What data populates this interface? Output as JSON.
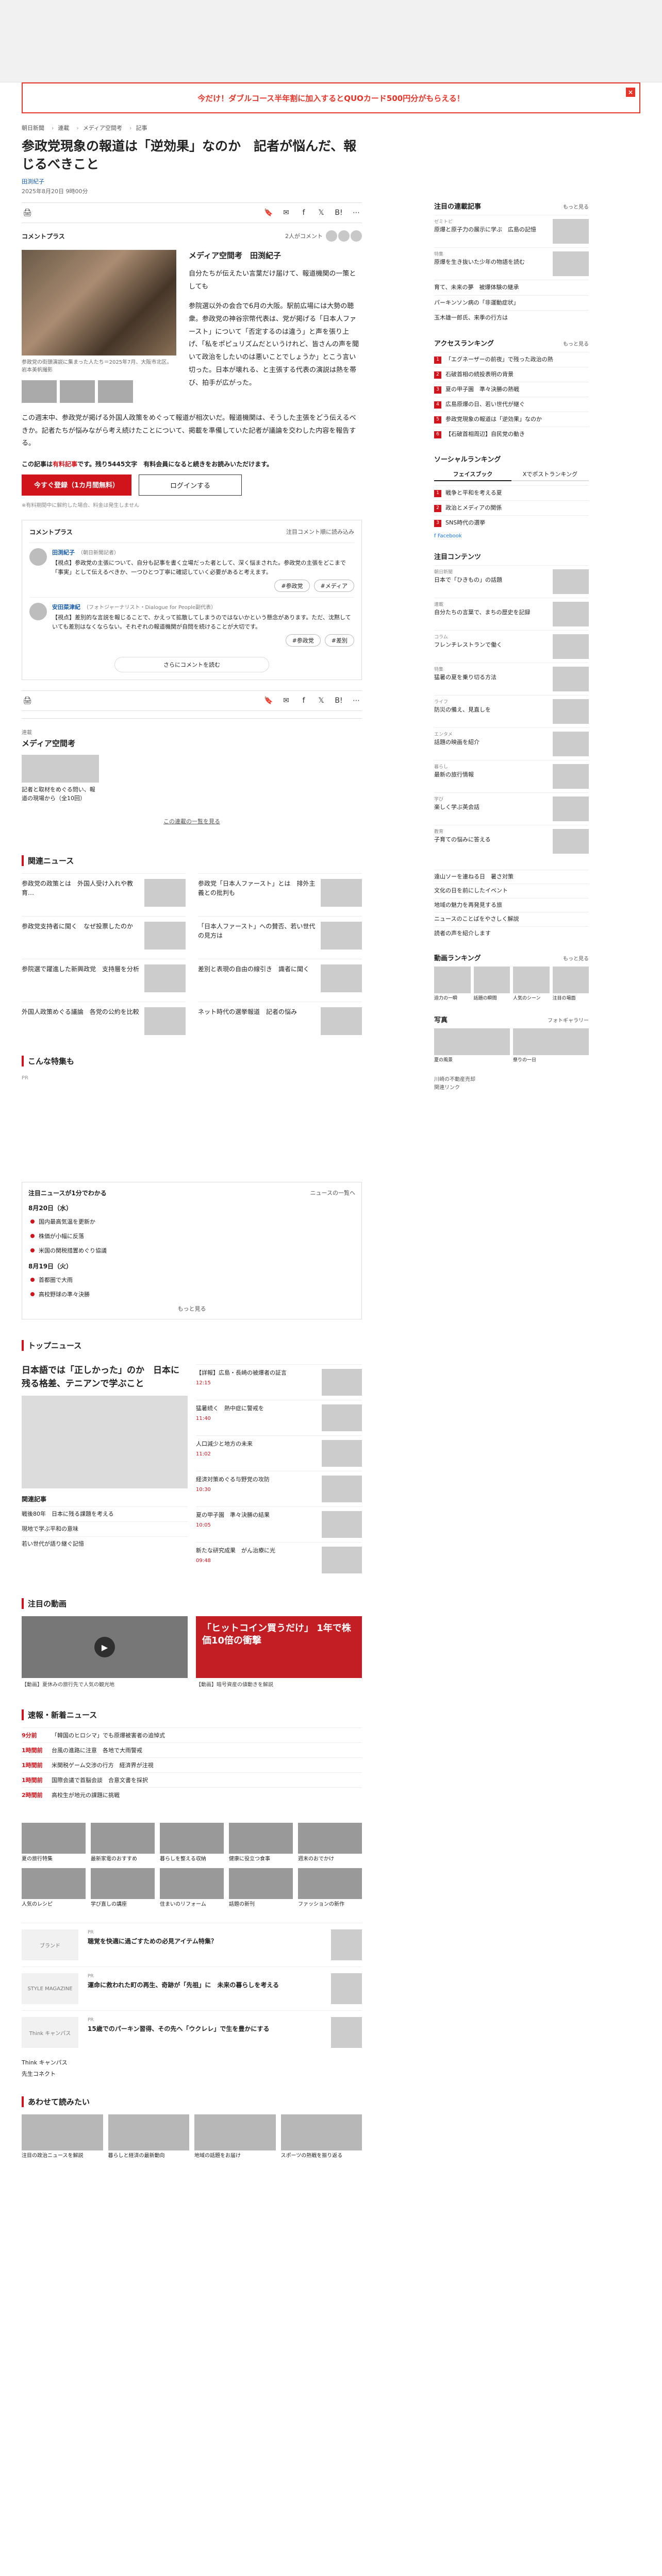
{
  "promo": {
    "text": "今だけ！ダブルコース半年割に加入するとQUOカード500円分がもらえる！",
    "close": "×"
  },
  "breadcrumb": [
    "朝日新聞",
    "連載",
    "メディア空間考",
    "記事"
  ],
  "article": {
    "title": "参政党現象の報道は「逆効果」なのか　記者が悩んだ、報じるべきこと",
    "byline_prefix": "",
    "author": "田渕紀子",
    "date": "2025年8月20日 9時00分",
    "commentplus_label": "コメントプラス",
    "commentplus_count": "2人がコメント",
    "commentplus_more": "(2件のコメント)",
    "lead_heading": "メディア空間考　田渕紀子",
    "lead_paragraph_1": "自分たちが伝えたい言葉だけ届けて、報道機関の一策としても",
    "lead_paragraph_2": "参院選以外の会合で6月の大阪。駅前広場には大勢の聴衆。参政党の神谷宗幣代表は、党が掲げる「日本人ファースト」について「否定するのは違う」と声を張り上げ、「私をポピュリズムだというけれど、皆さんの声を聞いて政治をしたいのは悪いことでしょうか」とこう言い切った。日本が壊れる、と主張する代表の演説は熱を帯び、拍手が広がった。",
    "photo_caption": "参政党の街頭演説に集まった人たち＝2025年7月、大阪市北区。岩本美帆撮影",
    "body_paragraph": "この週末中、参政党が掲げる外国人政策をめぐって報道が相次いだ。報道機関は、そうした主張をどう伝えるべきか。記者たちが悩みながら考え続けたことについて、掲載を準備していた記者が議論を交わした内容を報告する。",
    "paywall_note_prefix": "この記事は",
    "paywall_note_red": "有料記事",
    "paywall_note_suffix": "です。残り5445文字　有料会員になると続きをお読みいただけます。",
    "btn_subscribe": "今すぐ登録（1カ月間無料）",
    "btn_login": "ログインする",
    "paywall_small": "※有料期間中に解約した場合、料金は発生しません"
  },
  "share": {
    "print": "🖨",
    "bookmark": "🔖",
    "mail": "✉",
    "facebook": "f",
    "x": "𝕏",
    "hatena": "B!",
    "more": "⋯"
  },
  "comment_box": {
    "title": "コメントプラス",
    "more_link": "注目コメント順に読み込み",
    "comments": [
      {
        "name": "田渕紀子",
        "role": "（朝日新聞記者）",
        "text": "【視点】参政党の主張について、自分も記事を書く立場だった者として、深く悩まされた。参政党の主張をどこまで「事実」として伝えるべきか、一つひとつ丁寧に確認していく必要があると考えます。",
        "actions": [
          "#参政党",
          "#メディア"
        ]
      },
      {
        "name": "安田菜津紀",
        "role": "（フォトジャーナリスト・Dialogue for People副代表）",
        "text": "【視点】差別的な言説を報じることで、かえって拡散してしまうのではないかという懸念があります。ただ、沈黙していても差別はなくならない。それぞれの報道機関が自問を続けることが大切です。",
        "actions": [
          "#参政党",
          "#差別"
        ]
      }
    ],
    "more_button": "さらにコメントを読む"
  },
  "series": {
    "label": "連載",
    "name": "メディア空間考",
    "card_title": "記者と取材をめぐる問い、報道の現場から（全10回）",
    "link": "この連載の一覧を見る"
  },
  "related": {
    "title": "関連ニュース",
    "items": [
      "参政党の政策とは　外国人受け入れや教育…",
      "参政党「日本人ファースト」とは　排外主義との批判も",
      "参政党支持者に聞く　なぜ投票したのか",
      "「日本人ファースト」への賛否、若い世代の見方は",
      "参院選で躍進した新興政党　支持層を分析",
      "差別と表現の自由の線引き　識者に聞く",
      "外国人政策めぐる議論　各党の公約を比較",
      "ネット時代の選挙報道　記者の悩み"
    ]
  },
  "featured_label": "こんな特集も",
  "ad_label": "PR",
  "news_1min": {
    "title": "注目ニュースが1分でわかる",
    "link": "ニュースの一覧へ",
    "date1": "8月20日（水）",
    "items1": [
      "国内最高気温を更新か",
      "株価が小幅に反落",
      "米国の関税措置めぐり協議"
    ],
    "date2": "8月19日（火）",
    "items2": [
      "首都圏で大雨",
      "高校野球の準々決勝"
    ],
    "more": "もっと見る"
  },
  "top_news": {
    "title": "トップニュース",
    "link": "トップページへ",
    "big_title": "日本語では「正しかった」のか　日本に残る格差、テニアンで学ぶこと",
    "related_label": "関連記事",
    "related_items": [
      "戦後80年　日本に残る課題を考える",
      "現地で学ぶ平和の意味",
      "若い世代が語り継ぐ記憶"
    ],
    "side_items": [
      {
        "t": "【詳報】広島・長崎の被爆者の証言",
        "m": "12:15"
      },
      {
        "t": "猛暑続く　熱中症に警戒を",
        "m": "11:40"
      },
      {
        "t": "人口減少と地方の未来",
        "m": "11:02"
      },
      {
        "t": "経済対策めぐる与野党の攻防",
        "m": "10:30"
      },
      {
        "t": "夏の甲子園　準々決勝の結果",
        "m": "10:05"
      },
      {
        "t": "新たな研究成果　がん治療に光",
        "m": "09:48"
      }
    ]
  },
  "video": {
    "title": "注目の動画",
    "items": [
      {
        "t": "【動画】夏休みの旅行先で人気の観光地"
      },
      {
        "label": "「ヒットコイン買うだけ」\n1年で株価10倍の衝撃",
        "t": "【動画】暗号資産の値動きを解説"
      }
    ]
  },
  "rank_news": {
    "title": "速報・新着ニュース",
    "link": "一覧へ",
    "rows": [
      {
        "time": "9分前",
        "t": "「韓国のヒロシマ」でも原爆被害者の追悼式"
      },
      {
        "time": "1時間前",
        "t": "台風の進路に注意　各地で大雨警戒"
      },
      {
        "time": "1時間前",
        "t": "米関税ゲーム交渉の行方　経済界が注視"
      },
      {
        "time": "1時間前",
        "t": "国際会議で首脳会談　合意文書を採択"
      },
      {
        "time": "2時間前",
        "t": "高校生が地元の課題に挑戦"
      }
    ]
  },
  "pr_grid": [
    "夏の旅行特集",
    "最新家電のおすすめ",
    "暮らしを整える収納",
    "健康に役立つ食事",
    "週末のおでかけ",
    "人気のレシピ",
    "学び直しの講座",
    "住まいのリフォーム",
    "話題の新刊",
    "ファッションの新作"
  ],
  "pr_articles": [
    {
      "tag": "PR",
      "t": "聴覚を快適に過ごすための必見アイテム特集？",
      "logo": "ブランド"
    },
    {
      "tag": "PR",
      "t": "運命に救われた町の再生、奇跡が「先祖」に　未来の暮らしを考える",
      "logo": "STYLE MAGAZINE"
    },
    {
      "tag": "PR",
      "t": "15歳でのパーキン習得、その先へ「ウクレレ」で生を豊かにする",
      "logo": "Think キャンパス"
    }
  ],
  "logos": [
    "Think キャンパス",
    "先生コネクト"
  ],
  "osusume": {
    "title": "あわせて読みたい",
    "items": [
      "注目の政治ニュースを解説",
      "暮らしと経済の最新動向",
      "地域の話題をお届け",
      "スポーツの熱戦を振り返る"
    ]
  },
  "sidebar": {
    "pickup": {
      "title": "注目の連載記事",
      "link": "もっと見る",
      "items": [
        {
          "lbl": "ゼミトピ",
          "t": "原爆と原子力の展示に学ぶ　広島の記憶"
        },
        {
          "lbl": "特集",
          "t": "原爆を生き抜いた少年の物語を読む"
        }
      ]
    },
    "text_items": [
      "育て、未来の夢　被爆体験の継承",
      "パーキンソン病の「非運動症状」",
      "玉木雄一郎氏、来季の行方は"
    ],
    "access": {
      "title": "アクセスランキング",
      "link": "もっと見る",
      "items": [
        "「エグネーザーの前夜」で残った政治の熱",
        "石破首相の続投表明の背景",
        "夏の甲子園　準々決勝の熱戦",
        "広島原爆の日、若い世代が継ぐ",
        "参政党現象の報道は「逆効果」なのか",
        "【石破首相周辺】自民党の動き"
      ]
    },
    "social": {
      "title": "ソーシャルランキング",
      "tabs": [
        "フェイスブック",
        "Xでポストランキング"
      ],
      "items": [
        "戦争と平和を考える夏",
        "政治とメディアの関係",
        "SNS時代の選挙"
      ],
      "facebook_label": "f Facebook"
    },
    "notice": {
      "title": "注目コンテンツ",
      "link": "",
      "items": [
        {
          "lbl": "朝日新聞",
          "t": "日本で「ひきもの」の話題"
        },
        {
          "lbl": "連載",
          "t": "自分たちの言葉で、まちの歴史を記録"
        },
        {
          "lbl": "コラム",
          "t": "フレンチレストランで働く"
        },
        {
          "lbl": "特集",
          "t": "猛暑の夏を乗り切る方法"
        },
        {
          "lbl": "ライフ",
          "t": "防災の備え、見直しを"
        },
        {
          "lbl": "エンタメ",
          "t": "話題の映画を紹介"
        },
        {
          "lbl": "暮らし",
          "t": "最新の旅行情報"
        },
        {
          "lbl": "学び",
          "t": "楽しく学ぶ英会話"
        },
        {
          "lbl": "教育",
          "t": "子育ての悩みに答える"
        }
      ]
    },
    "text_list": [
      "遠山ソーを連ねる日　暑さ対策",
      "文化の日を前にしたイベント",
      "地域の魅力を再発見する旅",
      "ニュースのことばをやさしく解説",
      "読者の声を紹介します"
    ],
    "sports": {
      "title": "動画ランキング",
      "link": "もっと見る",
      "items": [
        "迫力の一瞬",
        "話題の瞬間",
        "人気のシーン",
        "注目の場面"
      ]
    },
    "photo": {
      "title": "写真",
      "link": "フォトギャラリー",
      "items": [
        "夏の風景",
        "祭りの一日"
      ]
    },
    "footer": [
      "川崎の不動産売却",
      "関連リンク"
    ]
  }
}
